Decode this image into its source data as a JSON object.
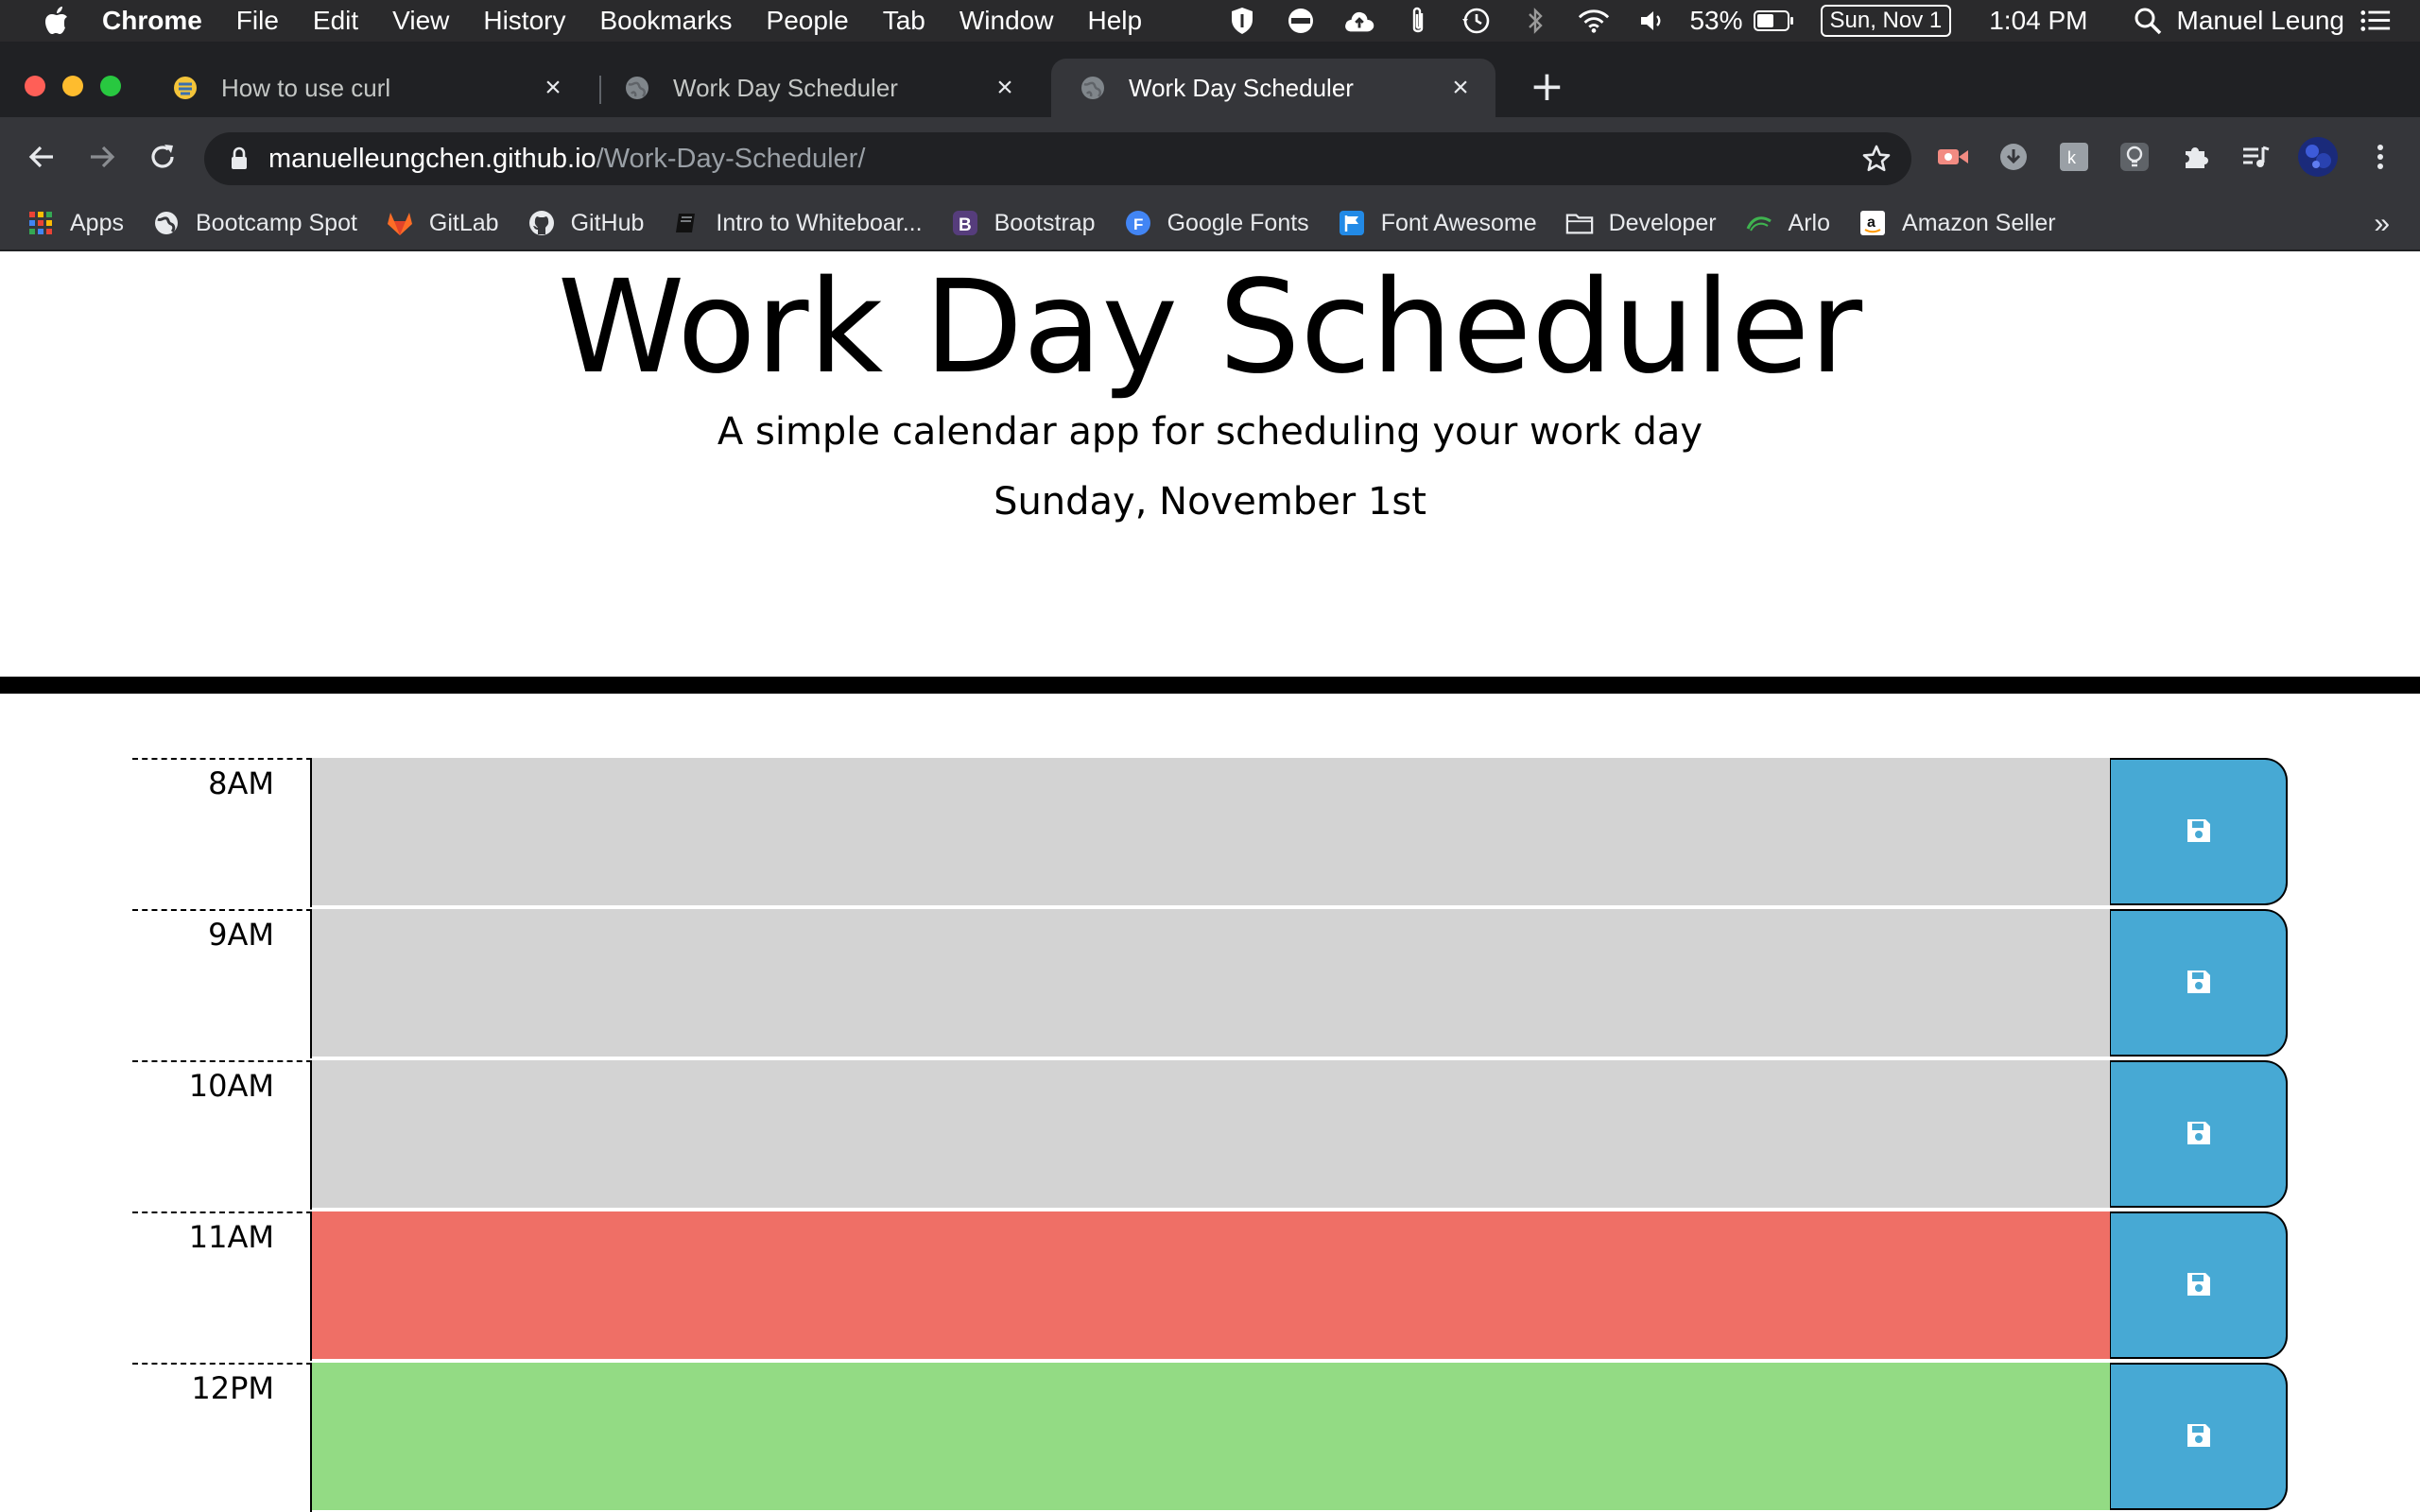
{
  "menubar": {
    "app": "Chrome",
    "items": [
      "File",
      "Edit",
      "View",
      "History",
      "Bookmarks",
      "People",
      "Tab",
      "Window",
      "Help"
    ],
    "battery": "53%",
    "date": "Sun, Nov 1",
    "time": "1:04 PM",
    "user": "Manuel Leung"
  },
  "tabs": [
    {
      "title": "How to use curl"
    },
    {
      "title": "Work Day Scheduler"
    },
    {
      "title": "Work Day Scheduler"
    }
  ],
  "omnibox": {
    "host": "manuelleungchen.github.io",
    "path": "/Work-Day-Scheduler/"
  },
  "bookmarks": [
    "Apps",
    "Bootcamp Spot",
    "GitLab",
    "GitHub",
    "Intro to Whiteboar...",
    "Bootstrap",
    "Google Fonts",
    "Font Awesome",
    "Developer",
    "Arlo",
    "Amazon Seller"
  ],
  "header": {
    "title": "Work Day Scheduler",
    "lead": "A simple calendar app for scheduling your work day",
    "current_day": "Sunday, November 1st"
  },
  "timeblocks": [
    {
      "hour": "8AM",
      "state": "past",
      "text": ""
    },
    {
      "hour": "9AM",
      "state": "past",
      "text": ""
    },
    {
      "hour": "10AM",
      "state": "past",
      "text": ""
    },
    {
      "hour": "11AM",
      "state": "present",
      "text": ""
    },
    {
      "hour": "12PM",
      "state": "future",
      "text": ""
    }
  ],
  "colors": {
    "past": "#d3d3d3",
    "present": "#ef6f66",
    "future": "#93db84",
    "save_button": "#47a9d4"
  }
}
